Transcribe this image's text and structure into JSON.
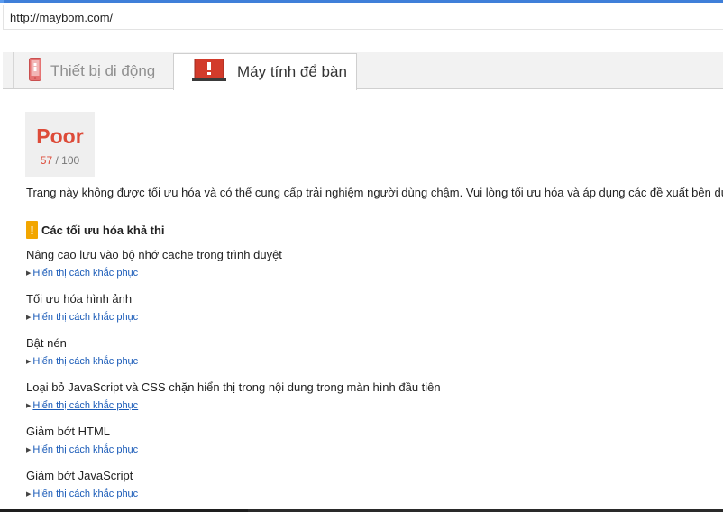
{
  "browser": {
    "url": "http://maybom.com/"
  },
  "tabs": [
    {
      "label": "Thiết bị di động",
      "icon": "mobile-phone-icon",
      "active": false
    },
    {
      "label": "Máy tính để bàn",
      "icon": "desktop-computer-icon",
      "active": true
    }
  ],
  "score": {
    "rating": "Poor",
    "value": "57",
    "max": "/ 100",
    "color": "#dd4b39"
  },
  "summary": "Trang này không được tối ưu hóa và có thể cung cấp trải nghiệm người dùng chậm. Vui lòng tối ưu hóa và áp dụng các đề xuất bên dưới.",
  "section": {
    "badge": "!",
    "title": "Các tối ưu hóa khả thi",
    "badge_color": "#f2a600"
  },
  "rules": [
    {
      "title": "Nâng cao lưu vào bộ nhớ cache trong trình duyệt",
      "link": "Hiển thị cách khắc phục"
    },
    {
      "title": "Tối ưu hóa hình ảnh",
      "link": "Hiển thị cách khắc phục"
    },
    {
      "title": "Bật nén",
      "link": "Hiển thị cách khắc phục"
    },
    {
      "title": "Loại bỏ JavaScript và CSS chặn hiển thị trong nội dung trong màn hình đầu tiên",
      "link": "Hiển thị cách khắc phục"
    },
    {
      "title": "Giảm bớt HTML",
      "link": "Hiển thị cách khắc phục"
    },
    {
      "title": "Giảm bớt JavaScript",
      "link": "Hiển thị cách khắc phục"
    }
  ]
}
